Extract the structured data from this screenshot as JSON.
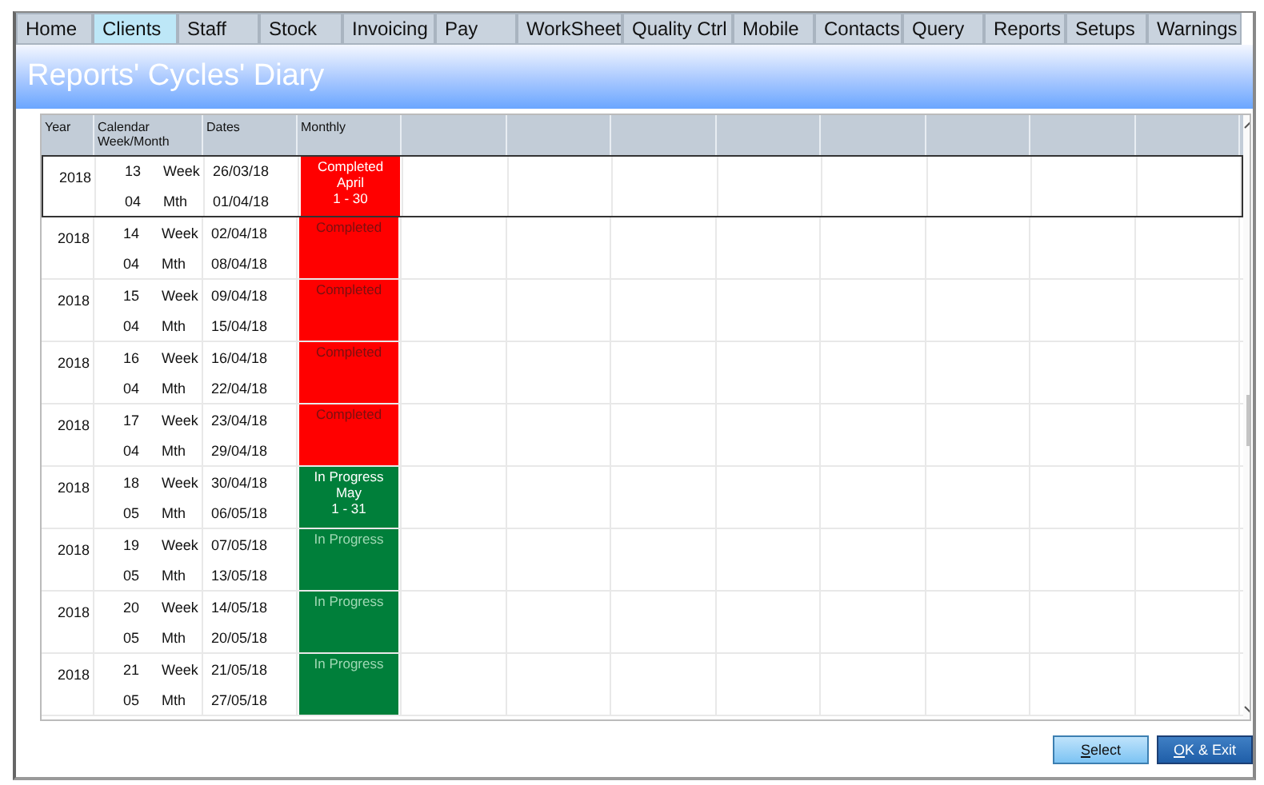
{
  "tabs": [
    {
      "label": "Home",
      "selected": false
    },
    {
      "label": "Clients",
      "selected": true
    },
    {
      "label": "Staff",
      "selected": false
    },
    {
      "label": "Stock",
      "selected": false
    },
    {
      "label": "Invoicing",
      "selected": false
    },
    {
      "label": "Pay",
      "selected": false
    },
    {
      "label": "WorkSheet",
      "selected": false
    },
    {
      "label": "Quality Ctrl",
      "selected": false
    },
    {
      "label": "Mobile",
      "selected": false
    },
    {
      "label": "Contacts",
      "selected": false
    },
    {
      "label": "Query",
      "selected": false
    },
    {
      "label": "Reports",
      "selected": false
    },
    {
      "label": "Setups",
      "selected": false
    },
    {
      "label": "Warnings",
      "selected": false
    }
  ],
  "title": "Reports' Cycles' Diary",
  "columns": [
    "Year",
    "Calendar Week/Month",
    "Dates",
    "Monthly"
  ],
  "rows": [
    {
      "year": "2018",
      "week": "13",
      "week_label": "Week",
      "month": "04",
      "month_label": "Mth",
      "start": "26/03/18",
      "end": "01/04/18",
      "kind": "completed",
      "faded": false,
      "monthly": [
        "Completed",
        "April",
        "1 - 30"
      ],
      "selected": true
    },
    {
      "year": "2018",
      "week": "14",
      "week_label": "Week",
      "month": "04",
      "month_label": "Mth",
      "start": "02/04/18",
      "end": "08/04/18",
      "kind": "completed",
      "faded": true,
      "monthly": [
        "Completed"
      ],
      "selected": false
    },
    {
      "year": "2018",
      "week": "15",
      "week_label": "Week",
      "month": "04",
      "month_label": "Mth",
      "start": "09/04/18",
      "end": "15/04/18",
      "kind": "completed",
      "faded": true,
      "monthly": [
        "Completed"
      ],
      "selected": false
    },
    {
      "year": "2018",
      "week": "16",
      "week_label": "Week",
      "month": "04",
      "month_label": "Mth",
      "start": "16/04/18",
      "end": "22/04/18",
      "kind": "completed",
      "faded": true,
      "monthly": [
        "Completed"
      ],
      "selected": false
    },
    {
      "year": "2018",
      "week": "17",
      "week_label": "Week",
      "month": "04",
      "month_label": "Mth",
      "start": "23/04/18",
      "end": "29/04/18",
      "kind": "completed",
      "faded": true,
      "monthly": [
        "Completed"
      ],
      "selected": false
    },
    {
      "year": "2018",
      "week": "18",
      "week_label": "Week",
      "month": "05",
      "month_label": "Mth",
      "start": "30/04/18",
      "end": "06/05/18",
      "kind": "in_progress",
      "faded": false,
      "monthly": [
        "In Progress",
        "May",
        "1 - 31"
      ],
      "selected": false
    },
    {
      "year": "2018",
      "week": "19",
      "week_label": "Week",
      "month": "05",
      "month_label": "Mth",
      "start": "07/05/18",
      "end": "13/05/18",
      "kind": "in_progress",
      "faded": true,
      "monthly": [
        "In Progress"
      ],
      "selected": false
    },
    {
      "year": "2018",
      "week": "20",
      "week_label": "Week",
      "month": "05",
      "month_label": "Mth",
      "start": "14/05/18",
      "end": "20/05/18",
      "kind": "in_progress",
      "faded": true,
      "monthly": [
        "In Progress"
      ],
      "selected": false
    },
    {
      "year": "2018",
      "week": "21",
      "week_label": "Week",
      "month": "05",
      "month_label": "Mth",
      "start": "21/05/18",
      "end": "27/05/18",
      "kind": "in_progress",
      "faded": true,
      "monthly": [
        "In Progress"
      ],
      "selected": false
    }
  ],
  "buttons": [
    {
      "label": "Select",
      "default": false
    },
    {
      "label": "OK & Exit",
      "default": true
    }
  ]
}
